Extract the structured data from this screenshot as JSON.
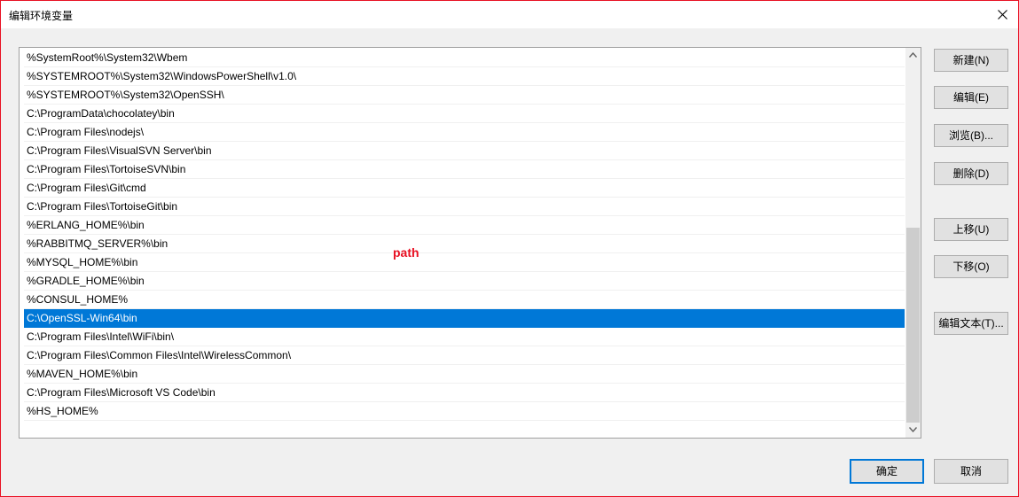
{
  "window": {
    "title": "编辑环境变量"
  },
  "list": {
    "items": [
      "%SystemRoot%\\System32\\Wbem",
      "%SYSTEMROOT%\\System32\\WindowsPowerShell\\v1.0\\",
      "%SYSTEMROOT%\\System32\\OpenSSH\\",
      "C:\\ProgramData\\chocolatey\\bin",
      "C:\\Program Files\\nodejs\\",
      "C:\\Program Files\\VisualSVN Server\\bin",
      "C:\\Program Files\\TortoiseSVN\\bin",
      "C:\\Program Files\\Git\\cmd",
      "C:\\Program Files\\TortoiseGit\\bin",
      "%ERLANG_HOME%\\bin",
      "%RABBITMQ_SERVER%\\bin",
      "%MYSQL_HOME%\\bin",
      "%GRADLE_HOME%\\bin",
      "%CONSUL_HOME%",
      "C:\\OpenSSL-Win64\\bin",
      "C:\\Program Files\\Intel\\WiFi\\bin\\",
      "C:\\Program Files\\Common Files\\Intel\\WirelessCommon\\",
      "%MAVEN_HOME%\\bin",
      "C:\\Program Files\\Microsoft VS Code\\bin",
      "%HS_HOME%"
    ],
    "selected_item": "C:\\OpenSSL-Win64\\bin"
  },
  "buttons": {
    "new": "新建(N)",
    "edit": "编辑(E)",
    "browse": "浏览(B)...",
    "delete": "删除(D)",
    "move_up": "上移(U)",
    "move_down": "下移(O)",
    "edit_text": "编辑文本(T)...",
    "ok": "确定",
    "cancel": "取消"
  },
  "annotation": {
    "text": "path",
    "color": "#e81123"
  },
  "colors": {
    "selection": "#0078d7",
    "window_border": "#e81123"
  },
  "icons": {
    "close": "close-icon",
    "scroll_up": "chevron-up-icon",
    "scroll_down": "chevron-down-icon"
  }
}
